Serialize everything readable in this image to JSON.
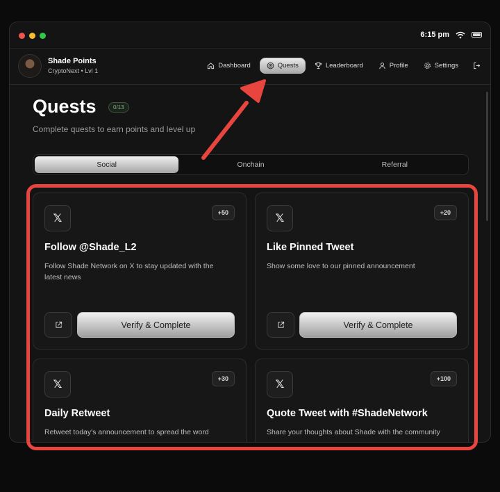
{
  "status_bar": {
    "time": "6:15 pm"
  },
  "user": {
    "name": "Shade Points",
    "subtitle": "CryptoNext • Lvl 1"
  },
  "nav": {
    "items": [
      {
        "label": "Dashboard",
        "icon": "home-icon"
      },
      {
        "label": "Quests",
        "icon": "target-icon",
        "active": true
      },
      {
        "label": "Leaderboard",
        "icon": "trophy-icon"
      },
      {
        "label": "Profile",
        "icon": "user-icon"
      },
      {
        "label": "Settings",
        "icon": "gear-icon"
      }
    ],
    "logout_icon": "logout-icon"
  },
  "page": {
    "title": "Quests",
    "progress_badge": "0/13",
    "subtitle": "Complete quests to earn points and level up"
  },
  "tabs": [
    {
      "label": "Social",
      "active": true
    },
    {
      "label": "Onchain"
    },
    {
      "label": "Referral"
    }
  ],
  "quests": [
    {
      "icon": "x-logo-icon",
      "points": "+50",
      "title": "Follow @Shade_L2",
      "description": "Follow Shade Network on X to stay updated with the latest news",
      "action_label": "Verify & Complete"
    },
    {
      "icon": "x-logo-icon",
      "points": "+20",
      "title": "Like Pinned Tweet",
      "description": "Show some love to our pinned announcement",
      "action_label": "Verify & Complete"
    },
    {
      "icon": "x-logo-icon",
      "points": "+30",
      "title": "Daily Retweet",
      "description": "Retweet today's announcement to spread the word"
    },
    {
      "icon": "x-logo-icon",
      "points": "+100",
      "title": "Quote Tweet with #ShadeNetwork",
      "description": "Share your thoughts about Shade with the community"
    }
  ],
  "colors": {
    "annotation": "#e8453f",
    "background": "#0b0b0b",
    "card": "#171717"
  }
}
